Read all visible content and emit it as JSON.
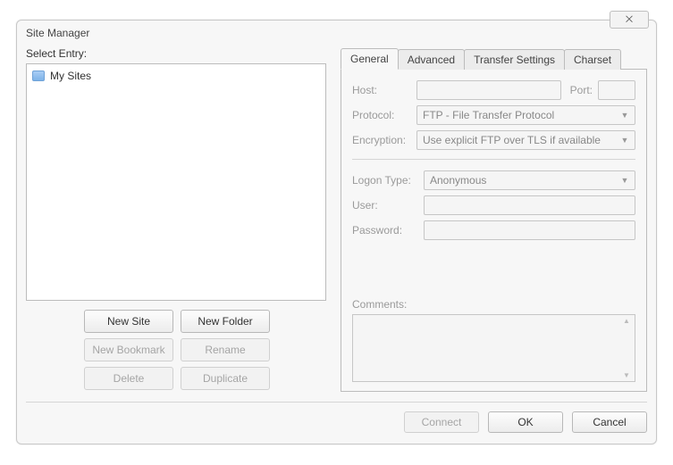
{
  "window": {
    "title": "Site Manager"
  },
  "close_glyph": "⨉",
  "left": {
    "select_entry_label": "Select Entry:",
    "tree": {
      "root_label": "My Sites"
    },
    "buttons": {
      "new_site": "New Site",
      "new_folder": "New Folder",
      "new_bookmark": "New Bookmark",
      "rename": "Rename",
      "delete": "Delete",
      "duplicate": "Duplicate"
    }
  },
  "tabs": {
    "general": "General",
    "advanced": "Advanced",
    "transfer": "Transfer Settings",
    "charset": "Charset"
  },
  "form": {
    "host_label": "Host:",
    "host_value": "",
    "port_label": "Port:",
    "port_value": "",
    "protocol_label": "Protocol:",
    "protocol_value": "FTP - File Transfer Protocol",
    "encryption_label": "Encryption:",
    "encryption_value": "Use explicit FTP over TLS if available",
    "logon_type_label": "Logon Type:",
    "logon_type_value": "Anonymous",
    "user_label": "User:",
    "user_value": "",
    "password_label": "Password:",
    "password_value": "",
    "comments_label": "Comments:",
    "comments_value": ""
  },
  "footer": {
    "connect": "Connect",
    "ok": "OK",
    "cancel": "Cancel"
  }
}
